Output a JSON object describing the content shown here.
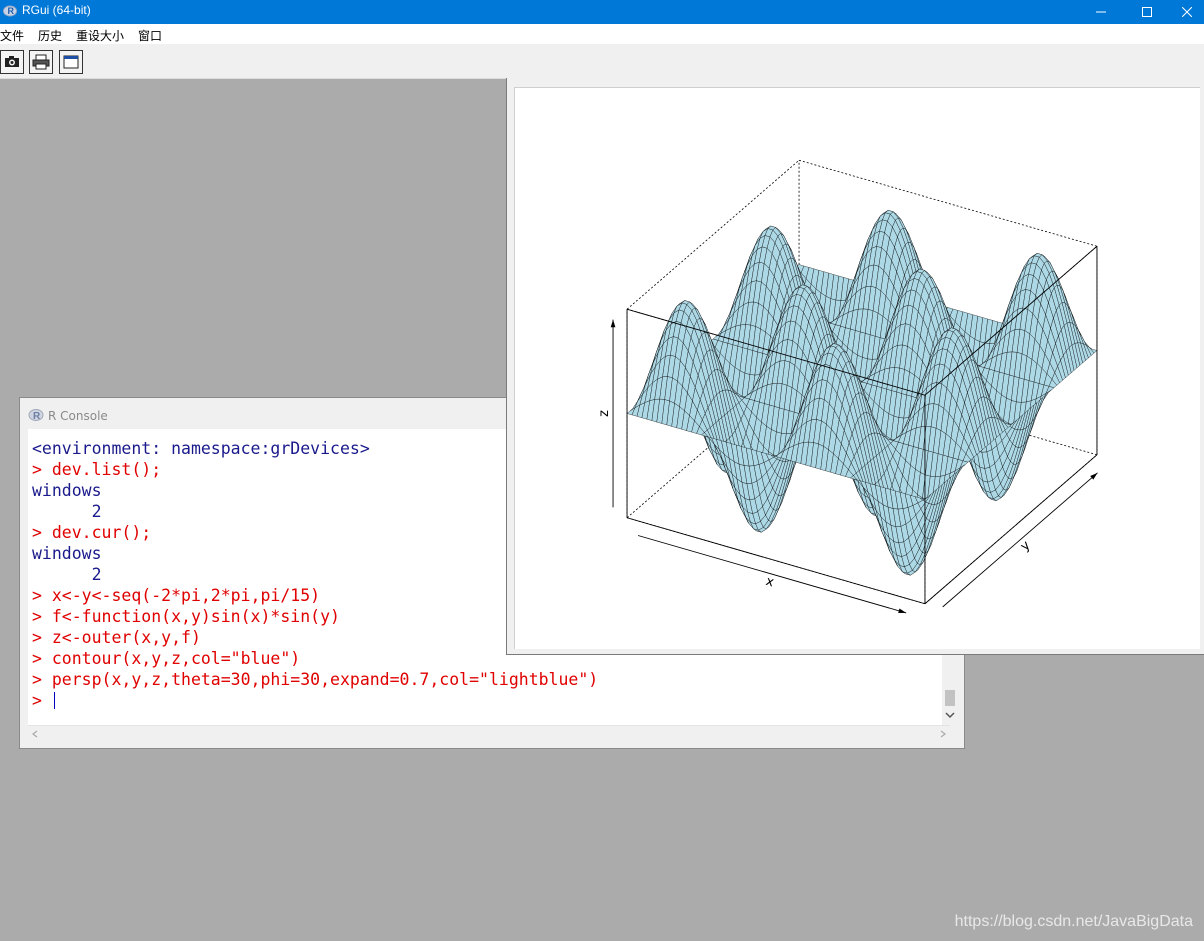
{
  "window": {
    "title": "RGui (64-bit)"
  },
  "menu": {
    "items": [
      "文件",
      "历史",
      "重设大小",
      "窗口"
    ]
  },
  "toolbar": {
    "buttons": [
      "camera-icon",
      "print-icon",
      "window-icon"
    ]
  },
  "console": {
    "title": "R Console",
    "lines": [
      {
        "text": "<environment: namespace:grDevices>",
        "kind": "output"
      },
      {
        "text": "> dev.list();",
        "kind": "input"
      },
      {
        "text": "windows",
        "kind": "output"
      },
      {
        "text": "      2",
        "kind": "output"
      },
      {
        "text": "> dev.cur();",
        "kind": "input"
      },
      {
        "text": "windows",
        "kind": "output"
      },
      {
        "text": "      2",
        "kind": "output"
      },
      {
        "text": "> x<-y<-seq(-2*pi,2*pi,pi/15)",
        "kind": "input"
      },
      {
        "text": "> f<-function(x,y)sin(x)*sin(y)",
        "kind": "input"
      },
      {
        "text": "> z<-outer(x,y,f)",
        "kind": "input"
      },
      {
        "text": "> contour(x,y,z,col=\"blue\")",
        "kind": "input"
      },
      {
        "text": "> persp(x,y,z,theta=30,phi=30,expand=0.7,col=\"lightblue\")",
        "kind": "input"
      },
      {
        "text": "> ",
        "kind": "prompt"
      }
    ]
  },
  "graph": {
    "axis_labels": {
      "x": "x",
      "y": "y",
      "z": "z"
    },
    "surface_color": "#add8e6"
  },
  "colors": {
    "titlebar": "#0078d7",
    "input_text": "#e00000",
    "output_text": "#1a1a8c",
    "workspace": "#ababab"
  },
  "watermark": "https://blog.csdn.net/JavaBigData"
}
